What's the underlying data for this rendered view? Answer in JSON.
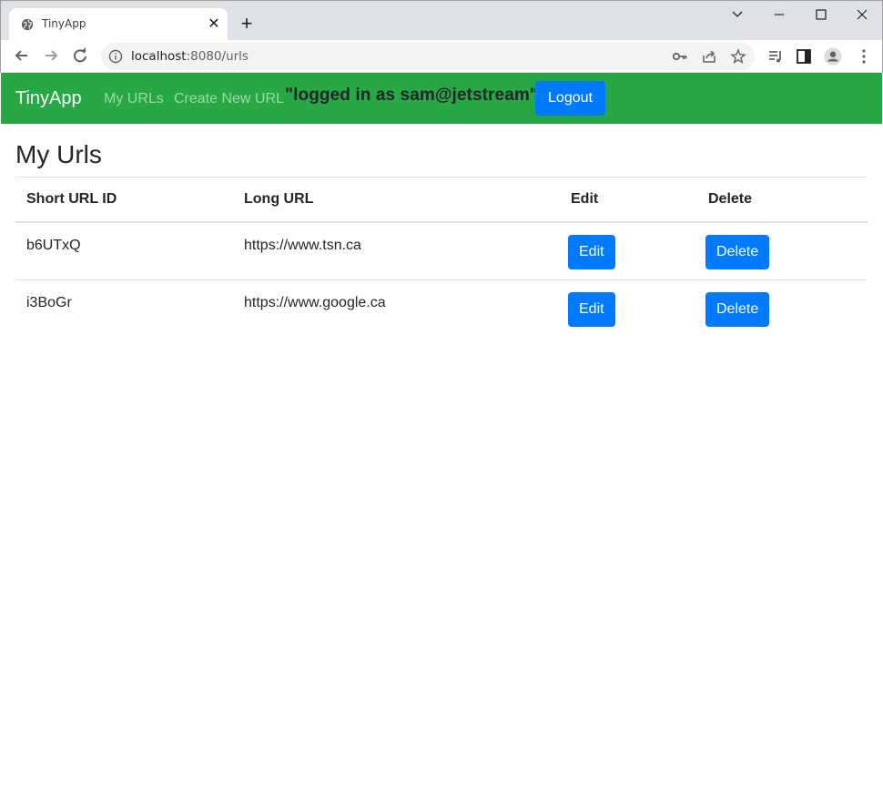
{
  "browser": {
    "tab_title": "TinyApp",
    "url_host": "localhost",
    "url_path": ":8080/urls"
  },
  "navbar": {
    "brand": "TinyApp",
    "links": [
      "My URLs",
      "Create New URL"
    ],
    "logged_in_text": "\"logged in as sam@jetstream\"",
    "logout_label": "Logout",
    "bg_color": "#28a745"
  },
  "main": {
    "title": "My Urls",
    "table": {
      "headers": [
        "Short URL ID",
        "Long URL",
        "Edit",
        "Delete"
      ],
      "rows": [
        {
          "id": "b6UTxQ",
          "long_url": "https://www.tsn.ca",
          "edit": "Edit",
          "delete": "Delete"
        },
        {
          "id": "i3BoGr",
          "long_url": "https://www.google.ca",
          "edit": "Edit",
          "delete": "Delete"
        }
      ]
    },
    "button_color": "#007bff"
  },
  "icons": {
    "tab_favicon": "globe-icon",
    "nav": [
      "back-arrow-icon",
      "forward-arrow-icon",
      "reload-icon"
    ],
    "omnibox": [
      "info-icon",
      "key-icon",
      "share-icon",
      "star-icon"
    ],
    "toolbar": [
      "media-queue-icon",
      "side-panel-icon",
      "profile-avatar-icon",
      "kebab-menu-icon"
    ]
  }
}
